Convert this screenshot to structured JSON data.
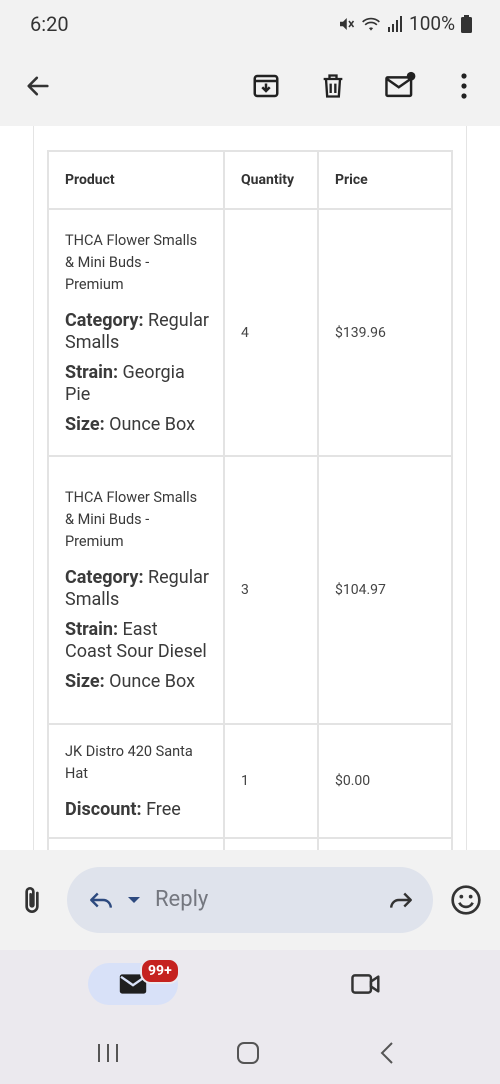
{
  "status_bar": {
    "time": "6:20",
    "battery": "100%"
  },
  "app_bar": {
    "back_icon": "arrow-left-icon",
    "archive_icon": "archive-icon",
    "delete_icon": "trash-icon",
    "mark_unread_icon": "mail-unread-icon",
    "more_icon": "more-vert-icon"
  },
  "table": {
    "headers": [
      "Product",
      "Quantity",
      "Price"
    ],
    "rows": [
      {
        "name": "THCA Flower Smalls & Mini Buds - Premium",
        "meta": [
          {
            "key": "Category:",
            "value": "Regular Smalls"
          },
          {
            "key": "Strain:",
            "value": "Georgia Pie"
          },
          {
            "key": "Size:",
            "value": "Ounce Box"
          }
        ],
        "quantity": "4",
        "price": "$139.96"
      },
      {
        "name": "THCA Flower Smalls & Mini Buds - Premium",
        "meta": [
          {
            "key": "Category:",
            "value": "Regular Smalls"
          },
          {
            "key": "Strain:",
            "value": "East Coast Sour Diesel"
          },
          {
            "key": "Size:",
            "value": "Ounce Box"
          }
        ],
        "quantity": "3",
        "price": "$104.97"
      },
      {
        "name": "JK Distro 420 Santa Hat",
        "meta": [
          {
            "key": "Discount:",
            "value": "Free"
          }
        ],
        "quantity": "1",
        "price": "$0.00"
      }
    ]
  },
  "reply_bar": {
    "placeholder": "Reply"
  },
  "bottom_nav": {
    "mail_badge": "99+"
  },
  "colors": {
    "accent_badge": "#c5221f",
    "reply_box": "#dfe3ec",
    "mail_pill": "#d8e1f8"
  }
}
